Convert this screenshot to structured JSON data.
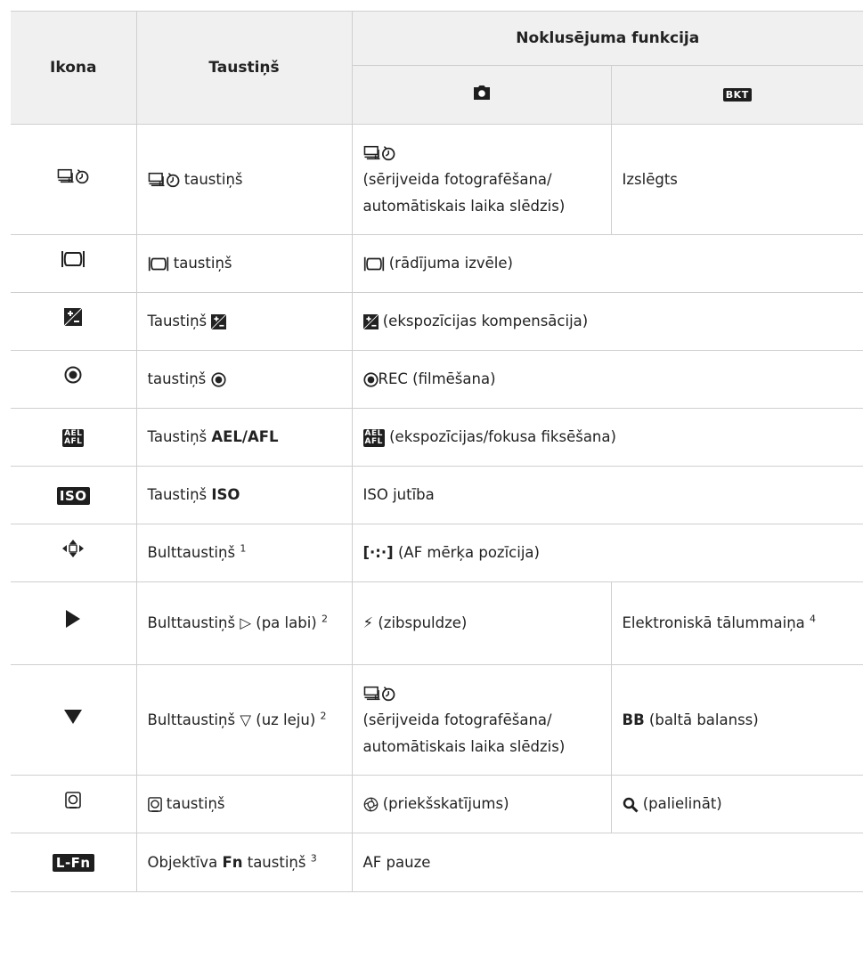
{
  "header": {
    "icon": "Ikona",
    "button": "Taustiņš",
    "default_function": "Noklusējuma funkcija",
    "sub_photo_icon": "camera-icon",
    "sub_bkt": "BKT"
  },
  "rows": [
    {
      "icon": "drive-selftimer-icon",
      "button": "taustiņš",
      "photo": "(sērijveida fotografēšana/ automātiskais laika slēdzis)",
      "bkt": "Izslēgts"
    },
    {
      "icon": "info-display-icon",
      "button": "taustiņš",
      "photo": "(rādījuma izvēle)"
    },
    {
      "icon": "exposure-compensation-icon",
      "button": "Taustiņš",
      "photo": "(ekspozīcijas kompensācija)"
    },
    {
      "icon": "record-icon",
      "button": "taustiņš",
      "photo_label": "REC",
      "photo": "(filmēšana)"
    },
    {
      "icon": "ael-afl-icon",
      "button": "Taustiņš",
      "button_bold": "AEL/AFL",
      "badge_top": "AEL",
      "badge_bottom": "AFL",
      "photo": "(ekspozīcijas/fokusa fiksēšana)"
    },
    {
      "icon": "iso-icon",
      "button": "Taustiņš",
      "button_bold": "ISO",
      "badge": "ISO",
      "photo": "ISO jutība"
    },
    {
      "icon": "arrow-pad-icon",
      "button": "Bulttaustiņš",
      "sup": "1",
      "photo_label": "[·:·]",
      "photo": "(AF mērķa pozīcija)"
    },
    {
      "icon": "play-right-icon",
      "button": "Bulttaustiņš ▷ (pa labi)",
      "sup": "2",
      "photo": "(zibspuldze)",
      "bkt": "Elektroniskā tālummaiņa",
      "bkt_sup": "4"
    },
    {
      "icon": "down-triangle-icon",
      "button": "Bulttaustiņš ▽ (uz leju)",
      "sup": "2",
      "photo": "(sērijveida fotografēšana/ automātiskais laika slēdzis)",
      "bkt_bold": "BB",
      "bkt": "(baltā balanss)"
    },
    {
      "icon": "preview-button-icon",
      "button": "taustiņš",
      "photo": "(priekšskatījums)",
      "bkt": "(palielināt)"
    },
    {
      "icon": "lens-fn-icon",
      "badge": "L-Fn",
      "button": "Objektīva",
      "button_bold": "Fn",
      "button_after": "taustiņš",
      "sup": "3",
      "photo": "AF pauze"
    }
  ]
}
